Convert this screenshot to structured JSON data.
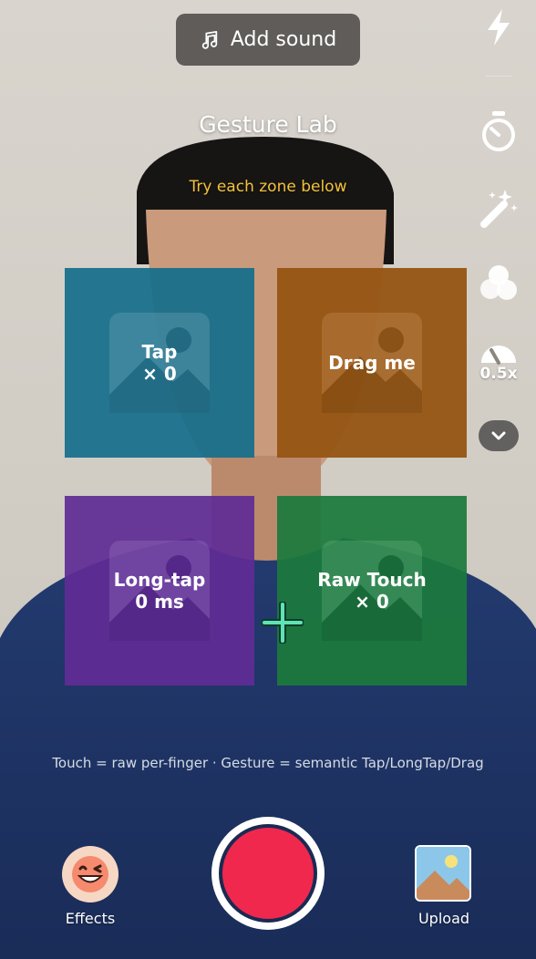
{
  "header": {
    "add_sound_label": "Add sound",
    "music_icon": "music-note-icon"
  },
  "screen": {
    "title": "Gesture Lab",
    "subtitle": "Try each zone below"
  },
  "zones": [
    {
      "id": "tap",
      "label": "Tap\n× 0"
    },
    {
      "id": "drag",
      "label": "Drag me"
    },
    {
      "id": "long",
      "label": "Long-tap\n0 ms"
    },
    {
      "id": "raw",
      "label": "Raw Touch\n× 0"
    }
  ],
  "colors": {
    "tap_zone": "#166E8C",
    "drag_zone": "#965412",
    "long_tap_zone": "#602C96",
    "raw_touch_zone": "#1C7A3C",
    "subtitle": "#F2C23B",
    "record": "#F0284E",
    "touch_marker": "#49D6A8"
  },
  "hint": "Touch = raw per-finger · Gesture = semantic Tap/LongTap/Drag",
  "side_tools": {
    "icons": [
      "flash-icon",
      "timer-icon",
      "beautify-wand-icon",
      "filters-icon",
      "speed-icon",
      "chevron-down-icon"
    ],
    "speed_label": "0.5x"
  },
  "bottom": {
    "effects_label": "Effects",
    "upload_label": "Upload"
  }
}
